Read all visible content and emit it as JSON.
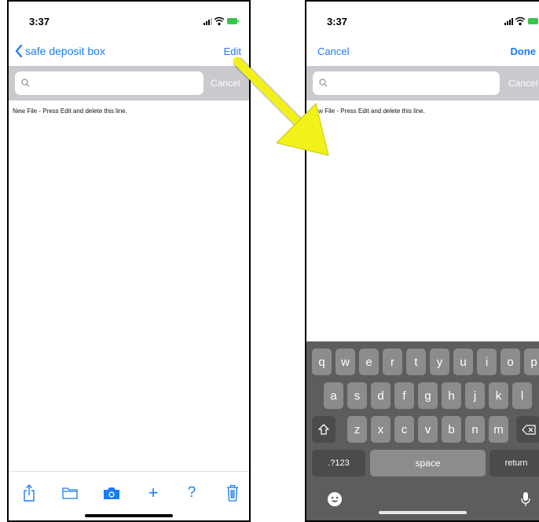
{
  "left_screen": {
    "status": {
      "time": "3:37"
    },
    "nav": {
      "back_label": "safe deposit box",
      "right_label": "Edit"
    },
    "search": {
      "placeholder": "",
      "cancel_label": "Cancel"
    },
    "content": {
      "text": "New File - Press Edit and delete this line."
    },
    "toolbar": {
      "items": [
        {
          "icon": "share-icon"
        },
        {
          "icon": "folder-icon"
        },
        {
          "icon": "camera-icon"
        },
        {
          "icon": "add-icon",
          "label": "+"
        },
        {
          "icon": "help-icon",
          "label": "?"
        },
        {
          "icon": "trash-icon"
        }
      ]
    }
  },
  "right_screen": {
    "status": {
      "time": "3:37"
    },
    "nav": {
      "left_label": "Cancel",
      "right_label": "Done"
    },
    "search": {
      "placeholder": "",
      "cancel_label": "Cancel"
    },
    "content": {
      "text": "New File - Press Edit and delete this line."
    },
    "keyboard": {
      "row1": [
        "q",
        "w",
        "e",
        "r",
        "t",
        "y",
        "u",
        "i",
        "o",
        "p"
      ],
      "row2": [
        "a",
        "s",
        "d",
        "f",
        "g",
        "h",
        "j",
        "k",
        "l"
      ],
      "row3": [
        "z",
        "x",
        "c",
        "v",
        "b",
        "n",
        "m"
      ],
      "numbers_key": ".?123",
      "space_key": "space",
      "return_key": "return"
    }
  },
  "colors": {
    "accent": "#1a7cf5",
    "search_bar_bg": "#c9c9ce",
    "keyboard_bg": "#5d5d5f",
    "key_bg": "#8c8c8e",
    "arrow": "#f2f21a"
  }
}
